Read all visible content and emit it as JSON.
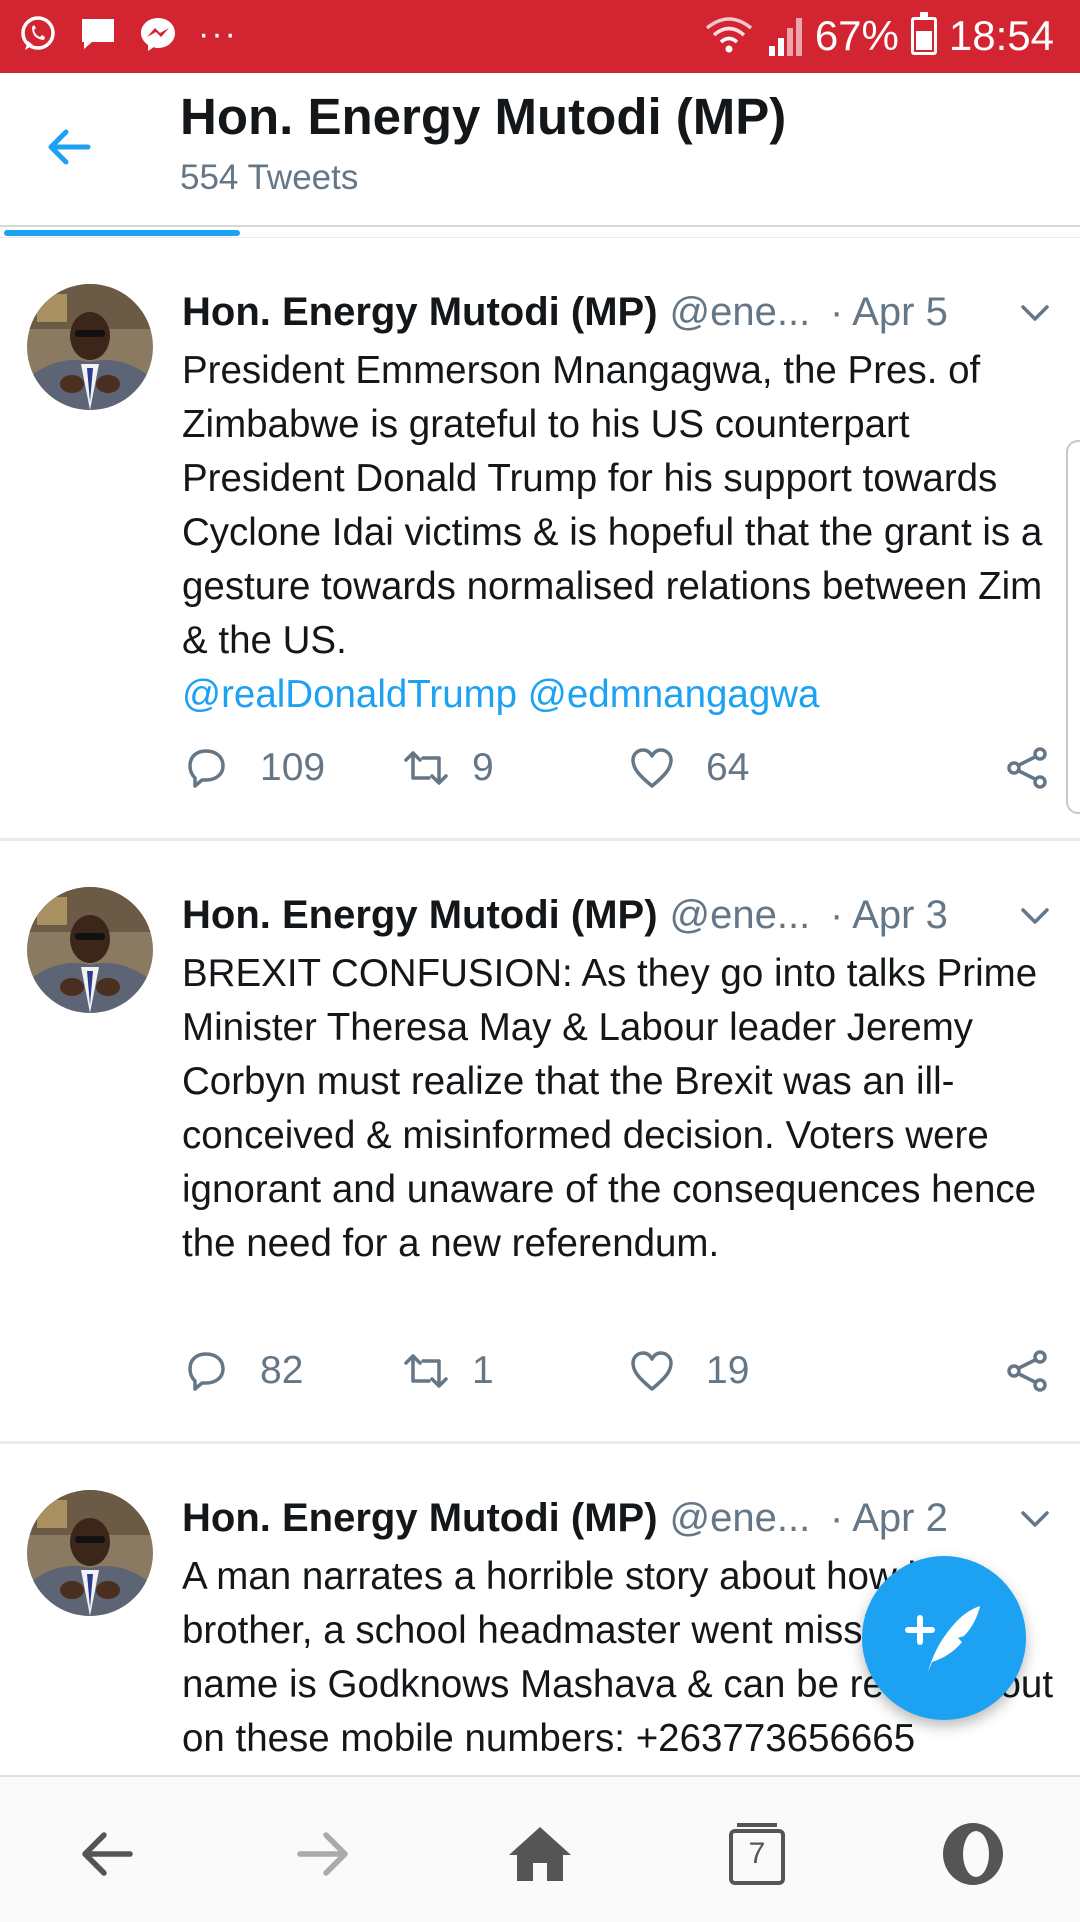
{
  "status_bar": {
    "battery": "67%",
    "time": "18:54",
    "more": "···",
    "battery_level": 0.67
  },
  "header": {
    "title": "Hon. Energy Mutodi (MP)",
    "subtitle": "554 Tweets"
  },
  "tweets": [
    {
      "name": "Hon. Energy Mutodi (MP)",
      "handle": "@ene...",
      "date": "· Apr 5",
      "text": "President Emmerson Mnangagwa, the Pres. of Zimbabwe is grateful to his US counterpart President Donald Trump for his support towards Cyclone Idai victims & is hopeful that the grant is a gesture towards normalised relations between Zim & the US.",
      "mentions": "@realDonaldTrump @edmnangagwa",
      "replies": "109",
      "retweets": "9",
      "likes": "64"
    },
    {
      "name": "Hon. Energy Mutodi (MP)",
      "handle": "@ene...",
      "date": "· Apr 3",
      "text": "BREXIT CONFUSION: As they go into talks Prime Minister Theresa May & Labour leader Jeremy Corbyn must realize that the Brexit was an ill-conceived & misinformed decision. Voters were ignorant and unaware of the consequences hence the need for a new referendum.",
      "replies": "82",
      "retweets": "1",
      "likes": "19"
    },
    {
      "name": "Hon. Energy Mutodi (MP)",
      "handle": "@ene...",
      "date": "· Apr 2",
      "text": "A man narrates a horrible story about how his brother, a school headmaster went missing. His name is Godknows Mashava & can be reached out on these mobile numbers: +263773656665"
    }
  ],
  "bottom_nav": {
    "tab_count": "7"
  },
  "colors": {
    "status_bar": "#d32531",
    "accent": "#1da1f2",
    "secondary_text": "#657786"
  }
}
